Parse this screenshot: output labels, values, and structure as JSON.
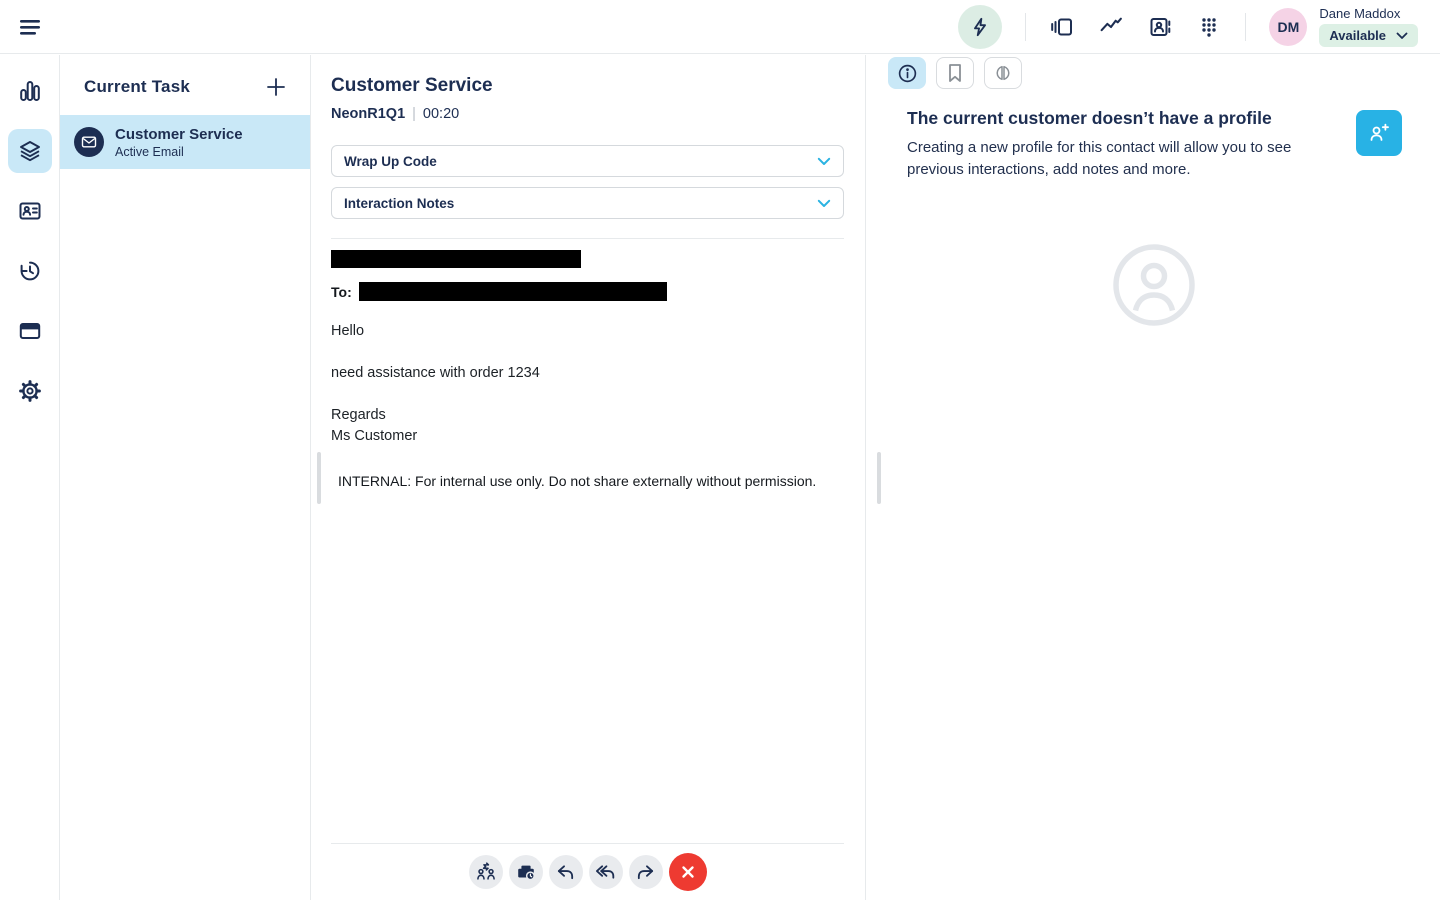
{
  "topbar": {
    "user_name": "Dane Maddox",
    "user_initials": "DM",
    "status_label": "Available",
    "icons": [
      "boost-lightning",
      "panels",
      "performance-chart",
      "contacts-book",
      "dialpad"
    ]
  },
  "rail": {
    "icons": [
      "analytics-bars",
      "interactions-layers",
      "contact-card",
      "history-clock",
      "apps-window",
      "settings-gear"
    ],
    "active_icon": "interactions-layers"
  },
  "task_panel": {
    "title": "Current Task",
    "task": {
      "title": "Customer Service",
      "subtitle": "Active Email"
    }
  },
  "interaction": {
    "title": "Customer Service",
    "queue": "NeonR1Q1",
    "separator": "|",
    "timer": "00:20",
    "wrapup_label": "Wrap Up Code",
    "notes_label": "Interaction Notes",
    "email": {
      "to_label": "To:",
      "greeting": "Hello",
      "body": "need assistance with order 1234",
      "signature": "Regards\nMs Customer",
      "internal_note": "INTERNAL: For internal use only. Do not share externally without permission."
    },
    "toolbar_icons": [
      "transfer",
      "park-email",
      "reply",
      "reply-all",
      "forward",
      "disconnect"
    ]
  },
  "profile_panel": {
    "tabs": [
      "info",
      "bookmark",
      "copilot-brain"
    ],
    "active_tab": "info",
    "heading": "The current customer doesn’t have a profile",
    "description": "Creating a new profile for this contact will allow you to see previous interactions, add notes and more."
  },
  "colors": {
    "navy": "#1d2e52",
    "accent_cyan": "#28b2e5",
    "active_blue": "#c9e8f7",
    "mint": "#dcede4",
    "status_green": "#ddf0e5",
    "avatar_pink": "#f5d3e6",
    "danger_red": "#ee3a31"
  }
}
